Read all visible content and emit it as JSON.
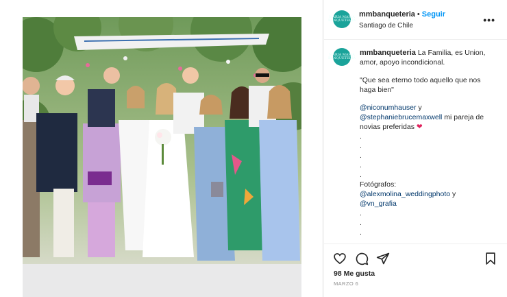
{
  "account": {
    "username": "mmbanqueteria",
    "separator": "•",
    "follow_label": "Seguir",
    "location": "Santiago de Chile",
    "avatar_text": "MARIA MARIA BANQUETERIA",
    "more_label": "•••"
  },
  "post": {
    "photo_alt": "Wedding group photo",
    "caption": {
      "username": "mmbanqueteria",
      "line1": "La Familia, es Union, amor, apoyo incondicional.",
      "line2": "\"Que sea eterno todo aquello que nos haga bien\"",
      "mention1": "@niconumhauser",
      "joiner1": " y ",
      "mention2": "@stephaniebrucemaxwell",
      "line3_rest": " mi pareja de novias preferidas ",
      "heart": "❤",
      "dots": [
        ".",
        ".",
        ".",
        ".",
        "."
      ],
      "photographers_label": "Fotógrafos:",
      "mention3": "@alexmolina_weddingphoto",
      "joiner2": " y",
      "mention4": "@vn_grafia",
      "dots2": [
        ".",
        ".",
        "."
      ]
    },
    "likes": "98 Me gusta",
    "date": "MARZO 6"
  },
  "icons": {
    "like": "heart-outline-icon",
    "comment": "comment-bubble-icon",
    "share": "paper-plane-icon",
    "save": "bookmark-icon"
  },
  "colors": {
    "follow": "#0095f6",
    "mention": "#00376b",
    "avatar": "#1aa39a",
    "heart": "#e0245e"
  }
}
